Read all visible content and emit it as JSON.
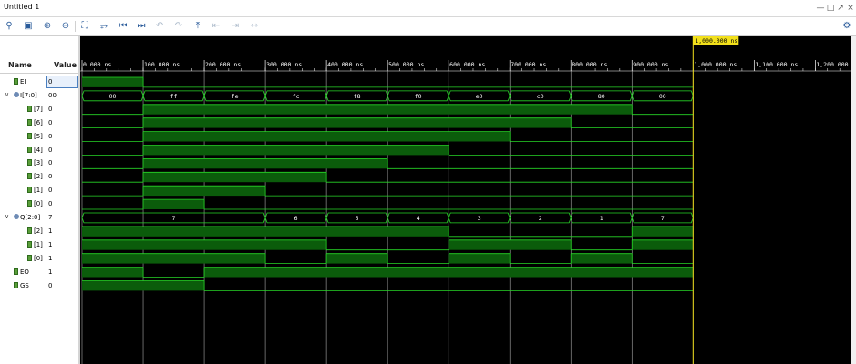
{
  "window": {
    "title": "Untitled 1"
  },
  "toolbar": {
    "icons": [
      "search-icon",
      "save-icon",
      "zoom-in-icon",
      "zoom-out-icon",
      "zoom-fit-icon",
      "go-to-cursor-icon",
      "go-to-time-0-icon",
      "go-to-last-time-icon",
      "previous-transition-icon",
      "next-transition-icon",
      "add-marker-icon",
      "previous-marker-icon",
      "next-marker-icon",
      "swap-cursors-icon",
      "settings-icon"
    ]
  },
  "headers": {
    "name": "Name",
    "value": "Value"
  },
  "signals": [
    {
      "name": "EI",
      "value": "0",
      "kind": "bit",
      "indent": 1
    },
    {
      "name": "I[7:0]",
      "value": "00",
      "kind": "bus",
      "indent": 0,
      "expanded": true
    },
    {
      "name": "[7]",
      "value": "0",
      "kind": "bit",
      "indent": 2
    },
    {
      "name": "[6]",
      "value": "0",
      "kind": "bit",
      "indent": 2
    },
    {
      "name": "[5]",
      "value": "0",
      "kind": "bit",
      "indent": 2
    },
    {
      "name": "[4]",
      "value": "0",
      "kind": "bit",
      "indent": 2
    },
    {
      "name": "[3]",
      "value": "0",
      "kind": "bit",
      "indent": 2
    },
    {
      "name": "[2]",
      "value": "0",
      "kind": "bit",
      "indent": 2
    },
    {
      "name": "[1]",
      "value": "0",
      "kind": "bit",
      "indent": 2
    },
    {
      "name": "[0]",
      "value": "0",
      "kind": "bit",
      "indent": 2
    },
    {
      "name": "Q[2:0]",
      "value": "7",
      "kind": "bus",
      "indent": 0,
      "expanded": true
    },
    {
      "name": "[2]",
      "value": "1",
      "kind": "bit",
      "indent": 2
    },
    {
      "name": "[1]",
      "value": "1",
      "kind": "bit",
      "indent": 2
    },
    {
      "name": "[0]",
      "value": "1",
      "kind": "bit",
      "indent": 2
    },
    {
      "name": "EO",
      "value": "1",
      "kind": "bit",
      "indent": 1
    },
    {
      "name": "GS",
      "value": "0",
      "kind": "bit",
      "indent": 1
    }
  ],
  "timeline": {
    "ticks": [
      "0.000 ns",
      "100.000 ns",
      "200.000 ns",
      "300.000 ns",
      "400.000 ns",
      "500.000 ns",
      "600.000 ns",
      "700.000 ns",
      "800.000 ns",
      "900.000 ns",
      "1,000.000 ns",
      "1,100.000 ns",
      "1,200.000 ns"
    ],
    "tick_values_ns": [
      0,
      100,
      200,
      300,
      400,
      500,
      600,
      700,
      800,
      900,
      1000,
      1100,
      1200
    ],
    "cursor_label": "1,000.000 ns",
    "cursor_ns": 1000,
    "sim_end_ns": 1000
  },
  "waves": {
    "EI": [
      [
        0,
        100,
        1
      ],
      [
        100,
        1000,
        0
      ]
    ],
    "I7": [
      [
        0,
        100,
        0
      ],
      [
        100,
        900,
        1
      ],
      [
        900,
        1000,
        0
      ]
    ],
    "I6": [
      [
        0,
        100,
        0
      ],
      [
        100,
        800,
        1
      ],
      [
        800,
        1000,
        0
      ]
    ],
    "I5": [
      [
        0,
        100,
        0
      ],
      [
        100,
        700,
        1
      ],
      [
        700,
        1000,
        0
      ]
    ],
    "I4": [
      [
        0,
        100,
        0
      ],
      [
        100,
        600,
        1
      ],
      [
        600,
        1000,
        0
      ]
    ],
    "I3": [
      [
        0,
        100,
        0
      ],
      [
        100,
        500,
        1
      ],
      [
        500,
        1000,
        0
      ]
    ],
    "I2": [
      [
        0,
        100,
        0
      ],
      [
        100,
        400,
        1
      ],
      [
        400,
        1000,
        0
      ]
    ],
    "I1": [
      [
        0,
        100,
        0
      ],
      [
        100,
        300,
        1
      ],
      [
        300,
        1000,
        0
      ]
    ],
    "I0": [
      [
        0,
        100,
        0
      ],
      [
        100,
        200,
        1
      ],
      [
        200,
        1000,
        0
      ]
    ],
    "Q2": [
      [
        0,
        600,
        1
      ],
      [
        600,
        900,
        0
      ],
      [
        900,
        1000,
        1
      ]
    ],
    "Q1": [
      [
        0,
        400,
        1
      ],
      [
        400,
        600,
        0
      ],
      [
        600,
        800,
        1
      ],
      [
        800,
        900,
        0
      ],
      [
        900,
        1000,
        1
      ]
    ],
    "Q0": [
      [
        0,
        300,
        1
      ],
      [
        300,
        400,
        0
      ],
      [
        400,
        500,
        1
      ],
      [
        500,
        600,
        0
      ],
      [
        600,
        700,
        1
      ],
      [
        700,
        800,
        0
      ],
      [
        800,
        900,
        1
      ],
      [
        900,
        1000,
        0
      ]
    ],
    "EO": [
      [
        0,
        100,
        1
      ],
      [
        100,
        200,
        0
      ],
      [
        200,
        1000,
        1
      ]
    ],
    "GS": [
      [
        0,
        200,
        1
      ],
      [
        200,
        1000,
        0
      ]
    ]
  },
  "bus_I": [
    [
      0,
      100,
      "00"
    ],
    [
      100,
      200,
      "ff"
    ],
    [
      200,
      300,
      "fe"
    ],
    [
      300,
      400,
      "fc"
    ],
    [
      400,
      500,
      "f8"
    ],
    [
      500,
      600,
      "f0"
    ],
    [
      600,
      700,
      "e0"
    ],
    [
      700,
      800,
      "c0"
    ],
    [
      800,
      900,
      "80"
    ],
    [
      900,
      1000,
      "00"
    ]
  ],
  "bus_Q": [
    [
      0,
      300,
      "7"
    ],
    [
      300,
      400,
      "6"
    ],
    [
      400,
      500,
      "5"
    ],
    [
      500,
      600,
      "4"
    ],
    [
      600,
      700,
      "3"
    ],
    [
      700,
      800,
      "2"
    ],
    [
      800,
      900,
      "1"
    ],
    [
      900,
      1000,
      "7"
    ]
  ],
  "colors": {
    "background": "#000000",
    "wave_fill": "#0b5c0b",
    "wave_line": "#27d627",
    "grid": "#c8c8c8",
    "cursor": "#f2e01b",
    "text": "#ffffff"
  }
}
